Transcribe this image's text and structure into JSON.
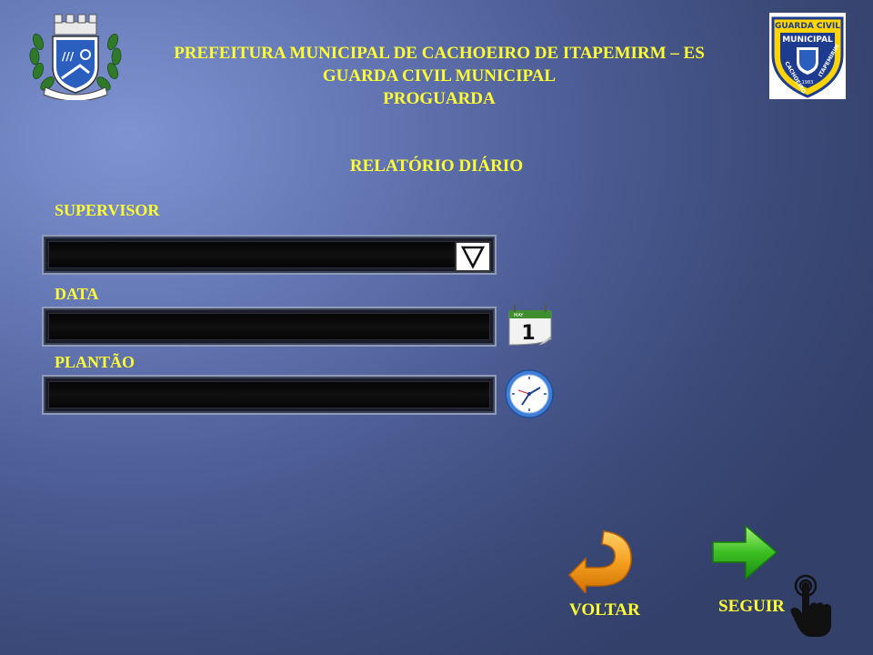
{
  "header": {
    "line1": "PREFEITURA MUNICIPAL  DE  CACHOEIRO  DE ITAPEMIRM  – ES",
    "line2": "GUARDA CIVIL  MUNICIPAL",
    "line3": "PROGUARDA"
  },
  "badge": {
    "top": "GUARDA CIVIL",
    "mid": "MUNICIPAL",
    "left": "CACHOEIRO",
    "right": "ITAPEMIRIM",
    "year": "1983"
  },
  "page_title": "RELATÓRIO  DIÁRIO",
  "form": {
    "supervisor_label": "SUPERVISOR",
    "supervisor_value": "",
    "data_label": "DATA",
    "data_value": "",
    "plantao_label": "PLANTÃO",
    "plantao_value": ""
  },
  "calendar": {
    "month": "MAY",
    "day": "1"
  },
  "actions": {
    "back_label": "VOLTAR",
    "next_label": "SEGUIR"
  },
  "colors": {
    "accent": "#ffff33",
    "field_bg": "#0a0a0a"
  }
}
